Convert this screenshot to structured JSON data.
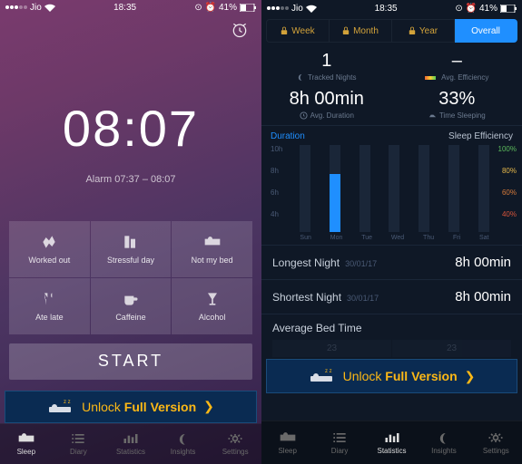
{
  "status": {
    "carrier": "Jio",
    "time": "18:35",
    "battery": "41%"
  },
  "left": {
    "time": "08:07",
    "alarm": "Alarm 07:37 – 08:07",
    "tags": [
      "Worked out",
      "Stressful day",
      "Not my bed",
      "Ate late",
      "Caffeine",
      "Alcohol"
    ],
    "start": "START",
    "unlock_a": "Unlock ",
    "unlock_b": "Full Version",
    "tabs": [
      "Sleep",
      "Diary",
      "Statistics",
      "Insights",
      "Settings"
    ]
  },
  "right": {
    "segments": [
      "Week",
      "Month",
      "Year",
      "Overall"
    ],
    "metrics": {
      "tracked": {
        "v": "1",
        "l": "Tracked Nights"
      },
      "eff": {
        "v": "–",
        "l": "Avg. Efficiency"
      },
      "dur": {
        "v": "8h 00min",
        "l": "Avg. Duration"
      },
      "sleep": {
        "v": "33%",
        "l": "Time Sleeping"
      }
    },
    "chart": {
      "left_title": "Duration",
      "right_title": "Sleep Efficiency"
    },
    "longest": {
      "k": "Longest Night",
      "d": "30/01/17",
      "v": "8h 00min"
    },
    "shortest": {
      "k": "Shortest Night",
      "d": "30/01/17",
      "v": "8h 00min"
    },
    "avgbed": "Average Bed Time",
    "avgslots": [
      "23",
      "23"
    ],
    "unlock_a": "Unlock ",
    "unlock_b": "Full Version",
    "tabs": [
      "Sleep",
      "Diary",
      "Statistics",
      "Insights",
      "Settings"
    ]
  },
  "chart_data": {
    "type": "bar",
    "title": "Duration / Sleep Efficiency",
    "categories": [
      "Sun",
      "Mon",
      "Tue",
      "Wed",
      "Thu",
      "Fri",
      "Sat"
    ],
    "series": [
      {
        "name": "Duration (h)",
        "values": [
          0,
          8,
          0,
          0,
          0,
          0,
          0
        ],
        "axis": "left"
      },
      {
        "name": "Sleep Efficiency (%)",
        "values": [
          null,
          null,
          null,
          null,
          null,
          null,
          null
        ],
        "axis": "right"
      }
    ],
    "yleft": {
      "label": "",
      "ticks": [
        "10h",
        "8h",
        "6h",
        "4h"
      ],
      "range": [
        4,
        10
      ]
    },
    "yright": {
      "label": "",
      "ticks": [
        "100%",
        "80%",
        "60%",
        "40%"
      ],
      "range": [
        40,
        100
      ]
    }
  }
}
